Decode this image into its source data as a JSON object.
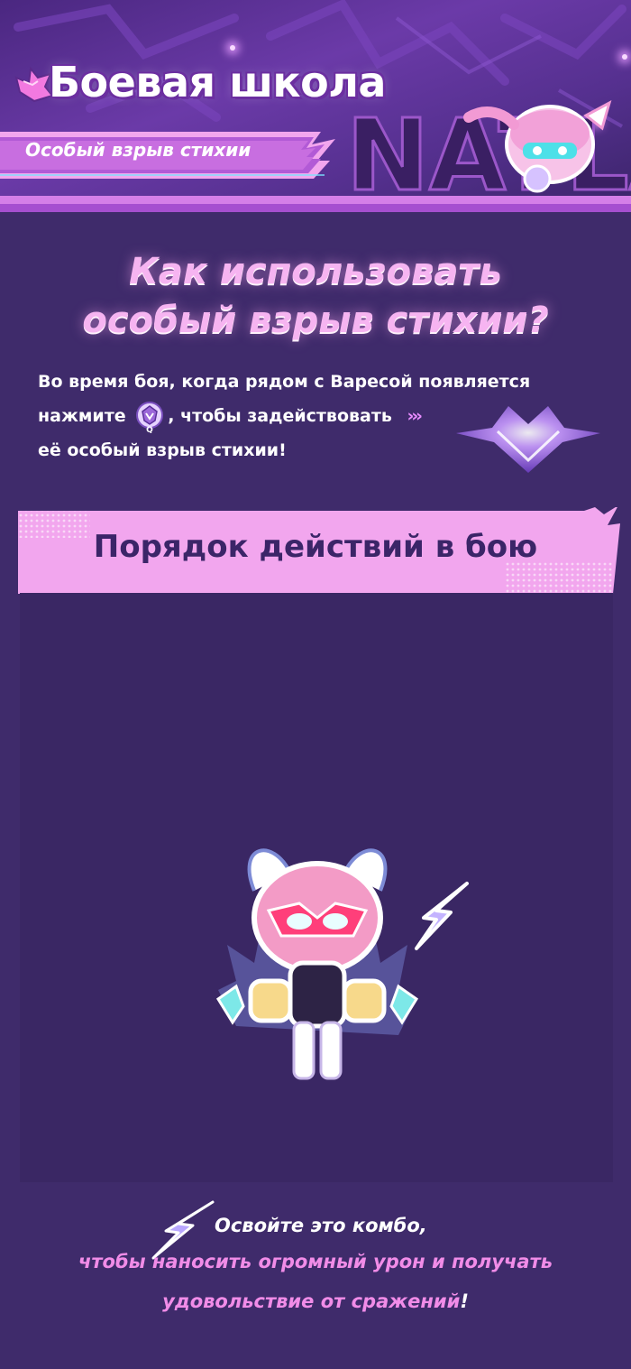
{
  "header": {
    "title": "Боевая школа",
    "subtitle": "Особый взрыв стихии",
    "nation_art_text": "NATLAN"
  },
  "howto": {
    "title_line1": "Как использовать",
    "title_line2": "особый взрыв стихии?",
    "desc_line1": "Во время боя, когда рядом с Варесой появляется",
    "desc_line2_before": "нажмите",
    "desc_line2_after": ", чтобы задействовать",
    "desc_line3": "её особый взрыв стихии!",
    "q_key": "Q",
    "chevrons": "›››"
  },
  "order": {
    "title": "Порядок действий в бою"
  },
  "footer": {
    "line1": "Освойте это комбо,",
    "line2": "чтобы наносить огромный урон и получать",
    "line3": "удовольствие от сражений",
    "line3_end": "!"
  },
  "colors": {
    "background": "#3f2b6b",
    "accent_pink": "#f18ce8",
    "banner_pink": "#f2a6ee",
    "title_pink": "#f6b4f1",
    "dark_text": "#3b2568"
  },
  "icons": {
    "header_heart": "heart-icon",
    "q_skill": "skill-q-icon",
    "burst": "heart-burst-icon",
    "bolt": "lightning-bolt-icon"
  }
}
